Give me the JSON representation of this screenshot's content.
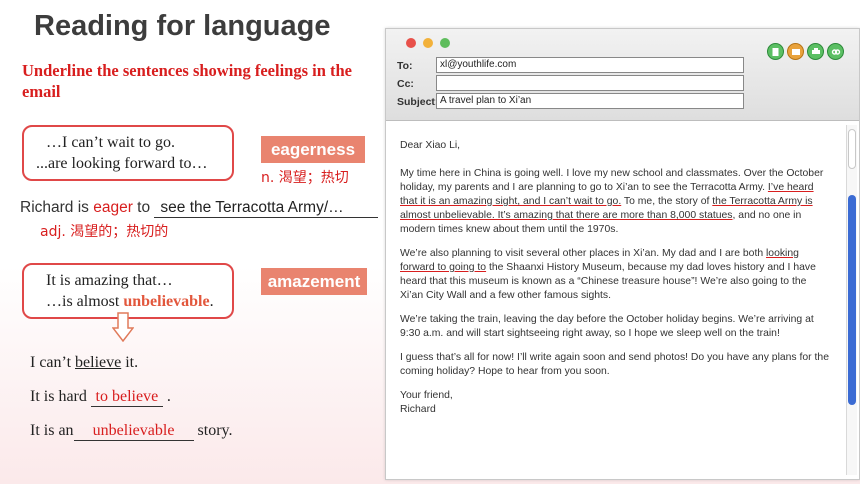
{
  "title": "Reading for language",
  "instruction": "Underline the sentences showing feelings in the email",
  "box1": {
    "line1": "…I can’t wait to go.",
    "line2": "...are looking forward to…"
  },
  "box2": {
    "line1": "It is amazing that…",
    "line2a": "…is almost ",
    "line2b": "unbelievable",
    "line2c": "."
  },
  "tags": {
    "eagerness": "eagerness",
    "amazement": "amazement"
  },
  "noun_def": "n. 渴望；热切",
  "adj_def": "adj. 渴望的；热切的",
  "eager_sentence": {
    "before": "Richard is ",
    "word": "eager",
    "mid": " to ",
    "blank": "see the Terracotta Army/…"
  },
  "sentences": {
    "s1_before": "I can’t ",
    "s1_u": "believe",
    "s1_after": " it.",
    "s2_before": "It is hard ",
    "s2_blank": "to believe",
    "s2_after": " .",
    "s3_before": "It is an",
    "s3_blank": "unbelievable",
    "s3_after": "  story."
  },
  "email": {
    "to_label": "To:",
    "to_value": "xl@youthlife.com",
    "cc_label": "Cc:",
    "cc_value": "",
    "subject_label": "Subject:",
    "subject_value": "A travel plan to Xi’an",
    "greeting": "Dear Xiao Li,",
    "p1_a": "My time here in China is going well. I love my new school and classmates. Over the October holiday, my parents and I are planning to go to Xi’an to see the Terracotta Army. ",
    "p1_u1": "I’ve heard that it is an amazing sight, and I can’t wait to go.",
    "p1_b": " To me, the story of ",
    "p1_u2": "the Terracotta Army is almost unbelievable. It’s amazing that there are more than 8,000 statues",
    "p1_c": ", and no one in modern times knew about them until the 1970s.",
    "p2_a": "We’re also planning to visit several other places in Xi’an. My dad and I are both ",
    "p2_u": "looking forward to going to",
    "p2_b": " the Shaanxi History Museum, because my dad loves history and I have heard that this museum is known as a “Chinese treasure house”! We’re also going to the Xi’an City Wall and a few other famous sights.",
    "p3": "We’re taking the train, leaving the day before the October holiday begins. We’re arriving at 9:30 a.m. and will start sightseeing right away, so I hope we sleep well on the train!",
    "p4": "I guess that’s all for now! I’ll write again soon and send photos! Do you have any plans for the coming holiday? Hope to hear from you soon.",
    "closing": "Your friend,",
    "signature": "Richard"
  }
}
